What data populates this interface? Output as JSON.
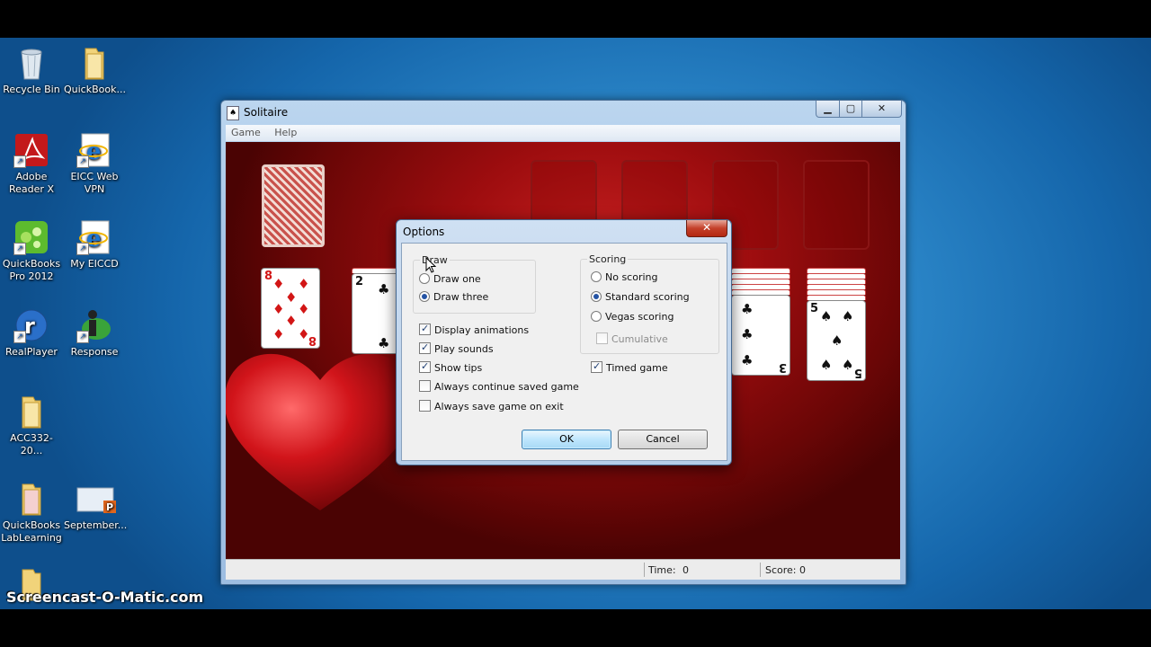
{
  "desktop": {
    "icons": [
      {
        "label": "Recycle Bin"
      },
      {
        "label": "QuickBook..."
      },
      {
        "label": "Adobe Reader X"
      },
      {
        "label": "EICC Web VPN"
      },
      {
        "label": "QuickBooks Pro 2012"
      },
      {
        "label": "My EICCD"
      },
      {
        "label": "RealPlayer"
      },
      {
        "label": "Response"
      },
      {
        "label": "ACC332-20..."
      },
      {
        "label": "QuickBooks LabLearning"
      },
      {
        "label": "September..."
      }
    ]
  },
  "window": {
    "title": "Solitaire",
    "buttons": {
      "minimize": "▁",
      "maximize": "▢",
      "close": "✕"
    },
    "menu": [
      "Game",
      "Help"
    ],
    "status": {
      "time_label": "Time:",
      "time_value": "0",
      "score_label": "Score: 0"
    }
  },
  "cards": {
    "tab1": {
      "rank": "8",
      "suit": "♦"
    },
    "tab2": {
      "rank": "2",
      "suit": "♣"
    },
    "tab6": {
      "rank": "3",
      "suit": "♣"
    },
    "tab7": {
      "rank": "5",
      "suit": "♠"
    }
  },
  "dialog": {
    "title": "Options",
    "close": "✕",
    "draw_group": "Draw",
    "draw_one": "Draw one",
    "draw_three": "Draw three",
    "scoring_group": "Scoring",
    "no_scoring": "No scoring",
    "standard_scoring": "Standard scoring",
    "vegas_scoring": "Vegas scoring",
    "cumulative": "Cumulative",
    "display_animations": "Display animations",
    "play_sounds": "Play sounds",
    "show_tips": "Show tips",
    "always_continue": "Always continue saved game",
    "always_save": "Always save game on exit",
    "timed_game": "Timed game",
    "ok": "OK",
    "cancel": "Cancel"
  },
  "watermark": "Screencast-O-Matic.com",
  "colors": {
    "felt": "#9e0d0f",
    "desktop": "#2b86c8",
    "accent": "#2453a4"
  }
}
